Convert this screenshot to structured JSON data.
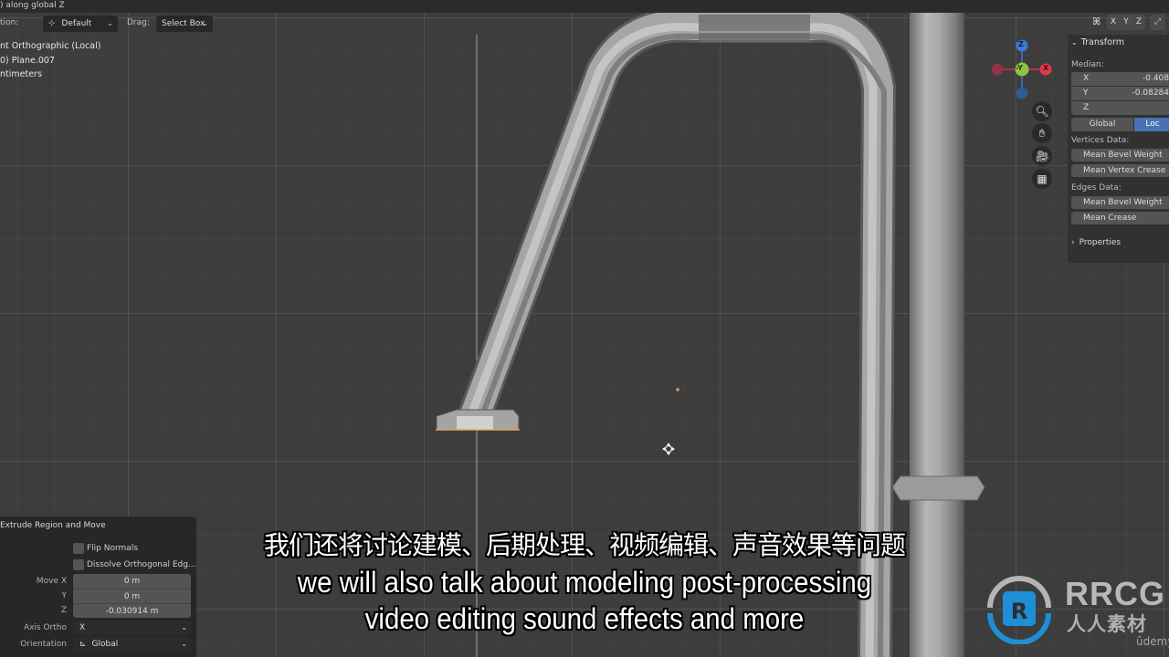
{
  "status": {
    "text": ") along global Z"
  },
  "header": {
    "orientation_label": "tion:",
    "orientation_value": "Default",
    "drag_label": "Drag:",
    "drag_value": "Select Box"
  },
  "overlay_info": {
    "view": "nt Orthographic (Local)",
    "object": "0) Plane.007",
    "units": "ntimeters"
  },
  "gizmo": {
    "z_label": "Z",
    "y_label": "-Y",
    "x_label": "X",
    "colors": {
      "z": "#3c7ad6",
      "y": "#8cc63e",
      "x": "#e0394f"
    }
  },
  "nav_buttons": [
    {
      "name": "zoom",
      "icon": "magnifier-plus-icon"
    },
    {
      "name": "pan",
      "icon": "hand-icon"
    },
    {
      "name": "camera",
      "icon": "camera-icon"
    },
    {
      "name": "ortho-toggle",
      "icon": "grid-icon"
    }
  ],
  "mirror": {
    "x": "X",
    "y": "Y",
    "z": "Z"
  },
  "npanel": {
    "title": "Transform",
    "median_label": "Median:",
    "x_label": "X",
    "x_value": "-0.408",
    "y_label": "Y",
    "y_value": "-0.08284",
    "z_label": "Z",
    "z_value": "",
    "global_label": "Global",
    "local_label": "Loc",
    "vertices_label": "Vertices Data:",
    "vert_bevel": "Mean Bevel Weight",
    "vert_crease": "Mean Vertex Crease",
    "edges_label": "Edges Data:",
    "edge_bevel": "Mean Bevel Weight",
    "edge_crease": "Mean Crease",
    "properties_label": "Properties",
    "accent": "#4772b3"
  },
  "operator": {
    "title": "Extrude Region and Move",
    "flip_normals": "Flip Normals",
    "dissolve": "Dissolve Orthogonal Edg...",
    "move_x_label": "Move X",
    "move_x": "0 m",
    "y_label": "Y",
    "move_y": "0 m",
    "z_label": "Z",
    "move_z": "-0.030914 m",
    "axis_ortho_label": "Axis Ortho",
    "axis_ortho": "X",
    "orientation_label": "Orientation",
    "orientation": "Global"
  },
  "subtitles": {
    "cn": "我们还将讨论建模、后期处理、视频编辑、声音效果等问题",
    "en1": "we will also talk about modeling post-processing",
    "en2": "video editing sound effects and more"
  },
  "watermark": {
    "brand": "RRCG",
    "brand_cn": "人人素材",
    "platform": "ûdemy",
    "logo_color": "#1e8fd6"
  }
}
